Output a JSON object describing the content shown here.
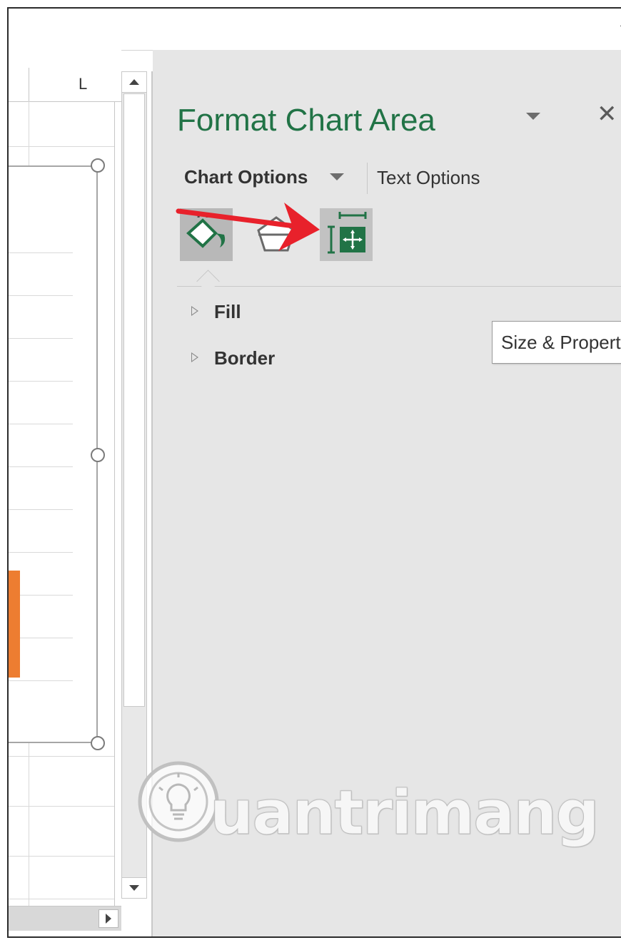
{
  "sheet": {
    "column_label": "L"
  },
  "chart_area": {
    "bar_color": "#ed7d31"
  },
  "pane": {
    "title": "Format Chart Area",
    "title_color": "#217346",
    "chart_options_label": "Chart Options",
    "text_options_label": "Text Options",
    "tabs": [
      {
        "name": "fill-line",
        "icon": "paint-bucket-icon"
      },
      {
        "name": "effects",
        "icon": "pentagon-icon"
      },
      {
        "name": "size-properties",
        "icon": "size-properties-icon",
        "tooltip": "Size & Properties"
      }
    ],
    "sections": [
      {
        "label": "Fill"
      },
      {
        "label": "Border"
      }
    ]
  },
  "tooltip": "Size & Properties",
  "annotation": {
    "arrow_color": "#e8212b"
  },
  "watermark": {
    "text": "uantrimang"
  }
}
